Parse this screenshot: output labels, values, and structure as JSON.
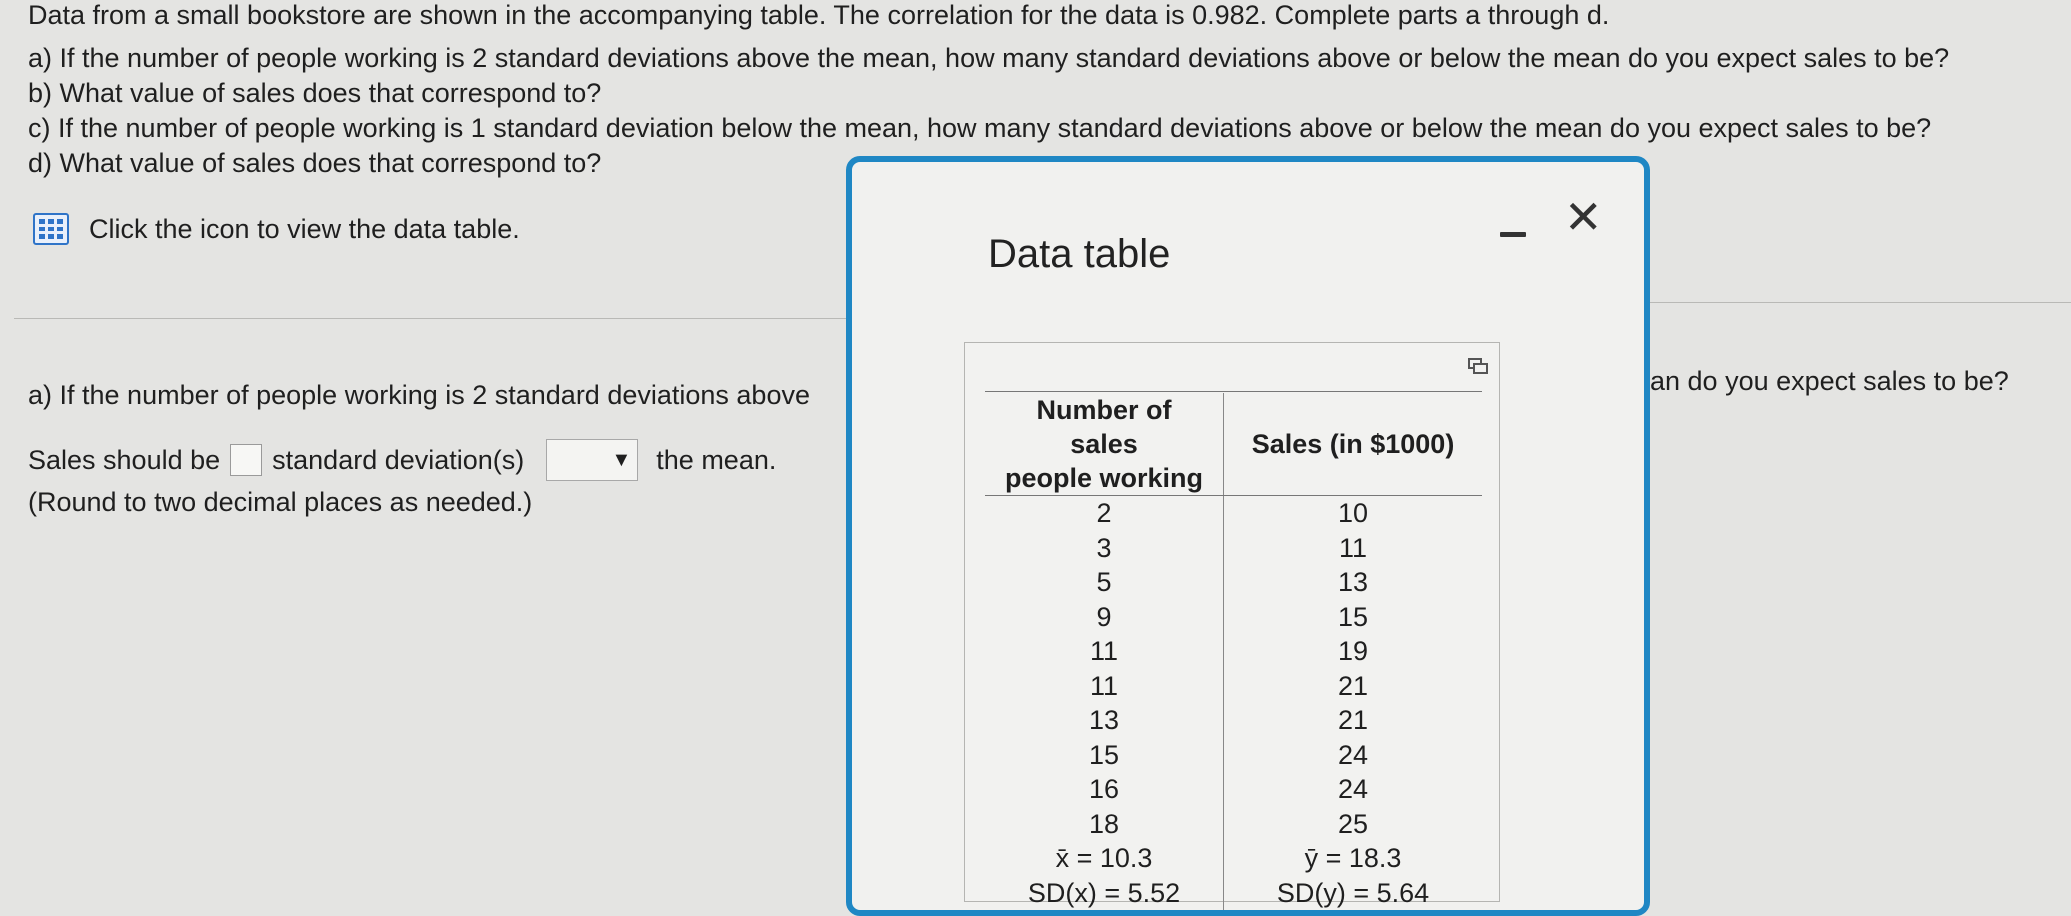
{
  "question": {
    "intro": "Data from a small bookstore are shown in the accompanying table. The correlation for the data is 0.982. Complete parts a through d.",
    "parts": [
      "a) If the number of people working is 2 standard deviations above the mean, how many standard deviations above or below the mean do you expect sales to be?",
      "b) What value of sales does that correspond to?",
      "c) If the number of people working is 1 standard deviation below the mean, how many standard deviations above or below the mean do you expect sales to be?",
      "d) What value of sales does that correspond to?"
    ],
    "data_link": "Click the icon to view the data table."
  },
  "answer": {
    "prompt_visible": "a) If the number of people working is 2 standard deviations above",
    "prompt_tail_visible": "an do you expect sales to be?",
    "sales_prefix": "Sales should be",
    "sales_middle": "standard deviation(s)",
    "sales_suffix": "the mean.",
    "value": "",
    "direction_selected": "",
    "round_note": "(Round to two decimal places as needed.)"
  },
  "modal": {
    "title": "Data table",
    "minimize_icon": "minimize-icon",
    "close_glyph": "✕",
    "table": {
      "col1_header": [
        "Number of sales",
        "people working"
      ],
      "col2_header": "Sales (in $1000)",
      "rows": [
        [
          "2",
          "10"
        ],
        [
          "3",
          "11"
        ],
        [
          "5",
          "13"
        ],
        [
          "9",
          "15"
        ],
        [
          "11",
          "19"
        ],
        [
          "11",
          "21"
        ],
        [
          "13",
          "21"
        ],
        [
          "15",
          "24"
        ],
        [
          "16",
          "24"
        ],
        [
          "18",
          "25"
        ]
      ],
      "summary": [
        [
          "x̄ = 10.3",
          "ȳ = 18.3"
        ],
        [
          "SD(x) = 5.52",
          "SD(y) = 5.64"
        ]
      ]
    }
  },
  "colors": {
    "accent": "#1f87c4",
    "link_icon": "#2f74c8"
  }
}
